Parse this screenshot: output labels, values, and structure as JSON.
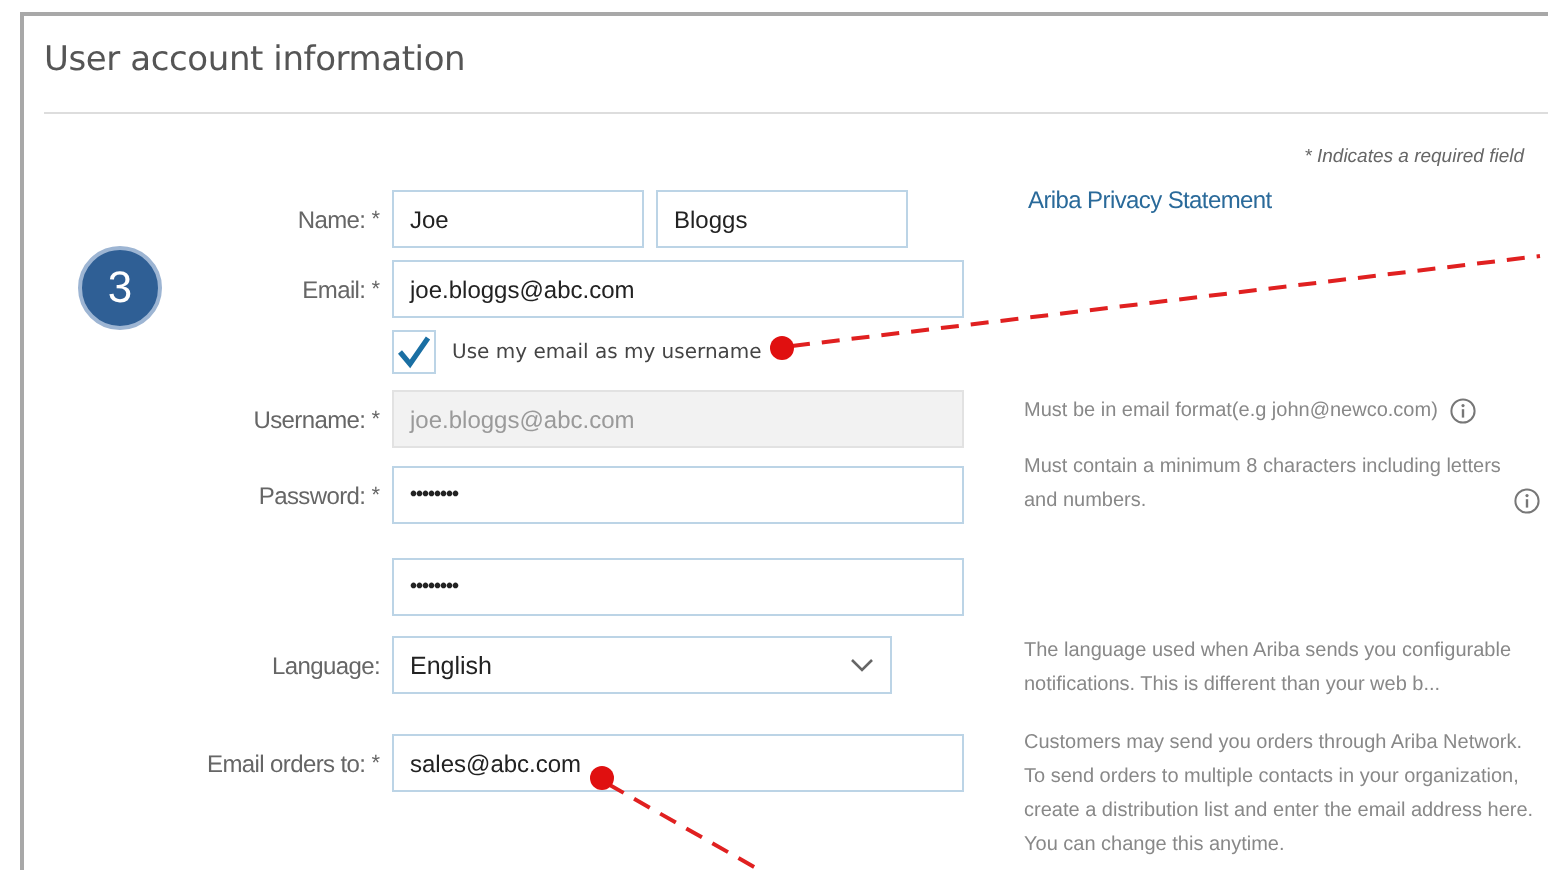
{
  "title": "User account information",
  "required_note": "* Indicates a required field",
  "required_mark": "*",
  "privacy_link": "Ariba Privacy Statement",
  "step_badge": "3",
  "fields": [
    {
      "kind": "name",
      "label": "Name:",
      "required": true,
      "values": [
        "Joe",
        "Bloggs"
      ]
    },
    {
      "kind": "text",
      "label": "Email:",
      "required": true,
      "value": "joe.bloggs@abc.com",
      "disabled": false
    },
    {
      "kind": "checkbox",
      "label": "Use my email as my username",
      "checked": true
    },
    {
      "kind": "text",
      "label": "Username:",
      "required": true,
      "value": "joe.bloggs@abc.com",
      "disabled": true,
      "help": "Must be in email format(e.g john@newco.com)",
      "help_icon": true
    },
    {
      "kind": "password",
      "label": "Password:",
      "required": true,
      "value": "••••••••",
      "help": "Must contain a minimum 8 characters including letters and numbers.",
      "help_icon": true
    },
    {
      "kind": "password",
      "value": "••••••••"
    },
    {
      "kind": "select",
      "label": "Language:",
      "required": false,
      "value": "English",
      "help": "The language used when Ariba sends you configurable notifications. This is different than your web b...",
      "help_icon": false
    },
    {
      "kind": "text",
      "label": "Email orders to:",
      "required": true,
      "value": "sales@abc.com",
      "disabled": false,
      "help": "Customers may send you orders through Ariba Network. To send orders to multiple contacts in your organization, create a distribution list and enter the email address here. You can change this anytime.",
      "help_icon": false
    }
  ]
}
